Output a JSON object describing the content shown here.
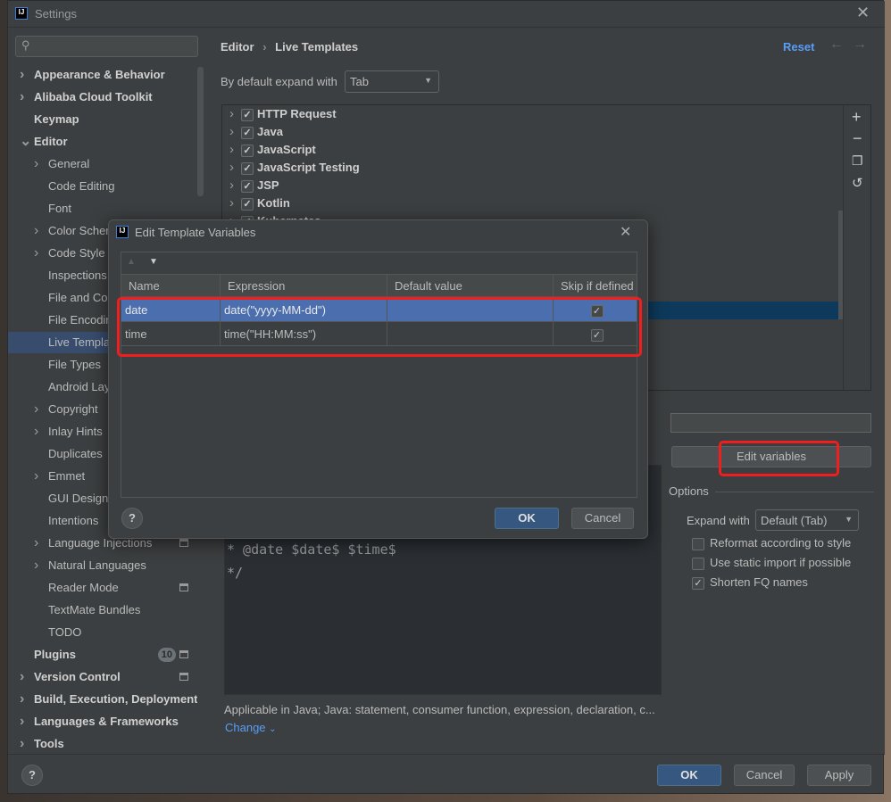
{
  "window": {
    "title": "Settings",
    "icon": "IJ"
  },
  "sidebar": {
    "search_placeholder": "",
    "items": [
      {
        "label": "Appearance & Behavior",
        "bold": true,
        "arrow": "right",
        "level": 0
      },
      {
        "label": "Alibaba Cloud Toolkit",
        "bold": true,
        "arrow": "right",
        "level": 0
      },
      {
        "label": "Keymap",
        "bold": true,
        "level": 0
      },
      {
        "label": "Editor",
        "bold": true,
        "arrow": "down",
        "level": 0
      },
      {
        "label": "General",
        "arrow": "right",
        "level": 1
      },
      {
        "label": "Code Editing",
        "level": 1
      },
      {
        "label": "Font",
        "level": 1
      },
      {
        "label": "Color Scheme",
        "arrow": "right",
        "level": 1
      },
      {
        "label": "Code Style",
        "arrow": "right",
        "level": 1
      },
      {
        "label": "Inspections",
        "level": 1,
        "icon": true
      },
      {
        "label": "File and Code Templates",
        "level": 1,
        "icon": true
      },
      {
        "label": "File Encodings",
        "level": 1,
        "icon": true
      },
      {
        "label": "Live Templates",
        "level": 1,
        "selected": true
      },
      {
        "label": "File Types",
        "level": 1
      },
      {
        "label": "Android Layout Editor",
        "level": 1
      },
      {
        "label": "Copyright",
        "arrow": "right",
        "level": 1,
        "icon": true
      },
      {
        "label": "Inlay Hints",
        "arrow": "right",
        "level": 1,
        "icon": true
      },
      {
        "label": "Duplicates",
        "level": 1
      },
      {
        "label": "Emmet",
        "arrow": "right",
        "level": 1
      },
      {
        "label": "GUI Designer",
        "level": 1,
        "icon": true
      },
      {
        "label": "Intentions",
        "level": 1
      },
      {
        "label": "Language Injections",
        "arrow": "right",
        "level": 1,
        "icon": true
      },
      {
        "label": "Natural Languages",
        "arrow": "right",
        "level": 1
      },
      {
        "label": "Reader Mode",
        "level": 1,
        "icon": true
      },
      {
        "label": "TextMate Bundles",
        "level": 1
      },
      {
        "label": "TODO",
        "level": 1
      },
      {
        "label": "Plugins",
        "bold": true,
        "level": 0,
        "badge": "10",
        "icon": true
      },
      {
        "label": "Version Control",
        "bold": true,
        "arrow": "right",
        "level": 0,
        "icon": true
      },
      {
        "label": "Build, Execution, Deployment",
        "bold": true,
        "arrow": "right",
        "level": 0
      },
      {
        "label": "Languages & Frameworks",
        "bold": true,
        "arrow": "right",
        "level": 0
      },
      {
        "label": "Tools",
        "bold": true,
        "arrow": "right",
        "level": 0
      }
    ]
  },
  "header": {
    "breadcrumb": [
      "Editor",
      "Live Templates"
    ],
    "reset": "Reset"
  },
  "expand": {
    "label": "By default expand with",
    "value": "Tab"
  },
  "template_groups": [
    {
      "label": "HTTP Request",
      "checked": true
    },
    {
      "label": "Java",
      "checked": true
    },
    {
      "label": "JavaScript",
      "checked": true
    },
    {
      "label": "JavaScript Testing",
      "checked": true
    },
    {
      "label": "JSP",
      "checked": true
    },
    {
      "label": "Kotlin",
      "checked": true
    },
    {
      "label": "Kubernetes",
      "checked": true
    }
  ],
  "editor": {
    "lines": [
      "* @date $date$ $time$",
      "*/"
    ]
  },
  "edit_variables_label": "Edit variables",
  "options": {
    "title": "Options",
    "expand_with_label": "Expand with",
    "expand_with_value": "Default (Tab)",
    "checkboxes": [
      {
        "label": "Reformat according to style",
        "checked": false
      },
      {
        "label": "Use static import if possible",
        "checked": false
      },
      {
        "label": "Shorten FQ names",
        "checked": true
      }
    ]
  },
  "applicable": "Applicable in Java; Java: statement, consumer function, expression, declaration, c...",
  "change_label": "Change",
  "footer": {
    "ok": "OK",
    "cancel": "Cancel",
    "apply": "Apply",
    "help": "?"
  },
  "dialog": {
    "title": "Edit Template Variables",
    "columns": [
      "Name",
      "Expression",
      "Default value",
      "Skip if defined"
    ],
    "rows": [
      {
        "name": "date",
        "expression": "date(\"yyyy-MM-dd\")",
        "default": "",
        "skip": true,
        "selected": true
      },
      {
        "name": "time",
        "expression": "time(\"HH:MM:ss\")",
        "default": "",
        "skip": true
      }
    ],
    "ok": "OK",
    "cancel": "Cancel",
    "help": "?"
  },
  "colors": {
    "accent": "#589df6",
    "selection": "#4b6eaf",
    "primary_button": "#365880",
    "highlight": "#f21d1d"
  }
}
